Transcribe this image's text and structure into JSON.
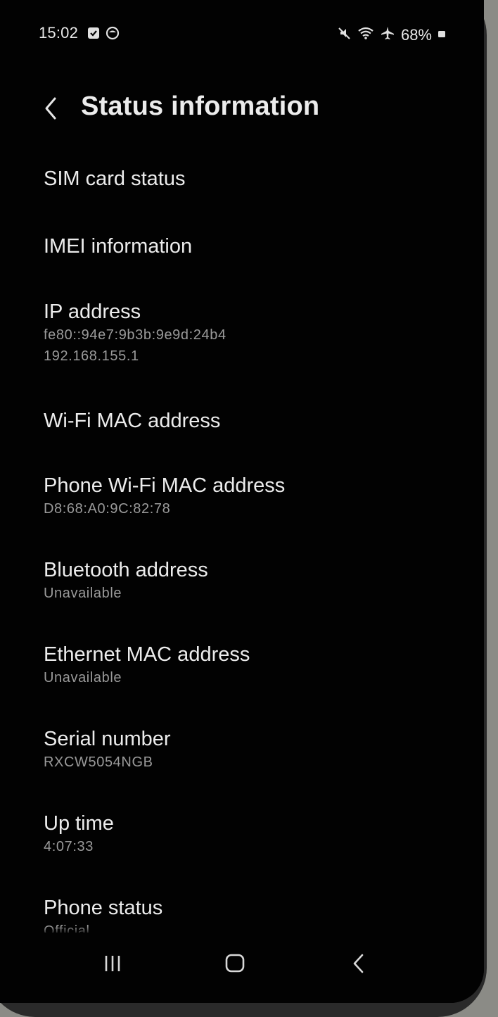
{
  "status_bar": {
    "time": "15:02",
    "battery": "68%",
    "left_icons": [
      "checkbox-notification-icon",
      "face-app-notification-icon"
    ],
    "right_icons": [
      "mute-icon",
      "wifi-icon",
      "airplane-mode-icon",
      "battery-icon"
    ]
  },
  "header": {
    "title": "Status information",
    "back_icon": "back-arrow-icon"
  },
  "items": [
    {
      "label": "SIM card status",
      "values": []
    },
    {
      "label": "IMEI information",
      "values": []
    },
    {
      "label": "IP address",
      "values": [
        "fe80::94e7:9b3b:9e9d:24b4",
        "192.168.155.1"
      ]
    },
    {
      "label": "Wi-Fi MAC address",
      "values": []
    },
    {
      "label": "Phone Wi-Fi MAC address",
      "values": [
        "D8:68:A0:9C:82:78"
      ]
    },
    {
      "label": "Bluetooth address",
      "values": [
        "Unavailable"
      ]
    },
    {
      "label": "Ethernet MAC address",
      "values": [
        "Unavailable"
      ]
    },
    {
      "label": "Serial number",
      "values": [
        "RXCW5054NGB"
      ]
    },
    {
      "label": "Up time",
      "values": [
        "4:07:33"
      ]
    },
    {
      "label": "Phone status",
      "values": [
        "Official"
      ]
    }
  ],
  "nav_bar": {
    "recents_icon": "recents-icon",
    "home_icon": "home-icon",
    "back_icon": "back-icon"
  },
  "colors": {
    "background": "#020202",
    "label_text": "#ececec",
    "value_text": "#9a9a9a"
  }
}
